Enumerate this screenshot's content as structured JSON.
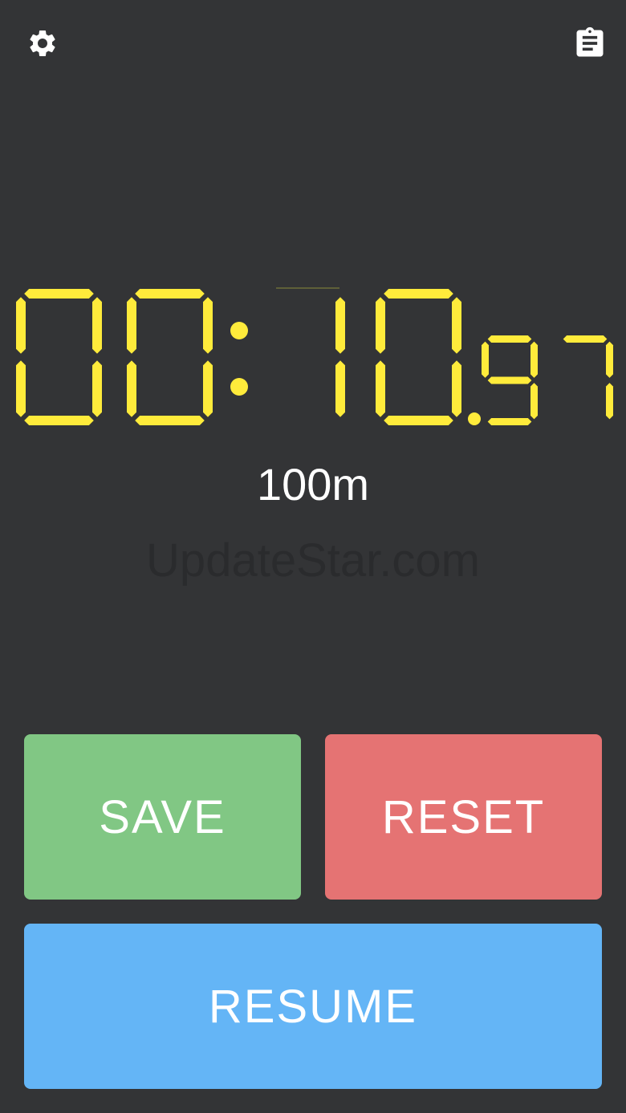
{
  "toolbar": {
    "settings_icon": "gear-icon",
    "log_icon": "clipboard-list-icon"
  },
  "timer": {
    "minutes": "00",
    "seconds": "10",
    "hundredths": "97",
    "color": "#FFEB3B"
  },
  "event": {
    "distance_label": "100m"
  },
  "watermark": {
    "text": "UpdateStar.com"
  },
  "buttons": {
    "save": {
      "label": "SAVE",
      "color": "#81C784"
    },
    "reset": {
      "label": "RESET",
      "color": "#E57373"
    },
    "resume": {
      "label": "RESUME",
      "color": "#64B5F6"
    }
  },
  "colors": {
    "background": "#333436",
    "text": "#FFFFFF"
  }
}
